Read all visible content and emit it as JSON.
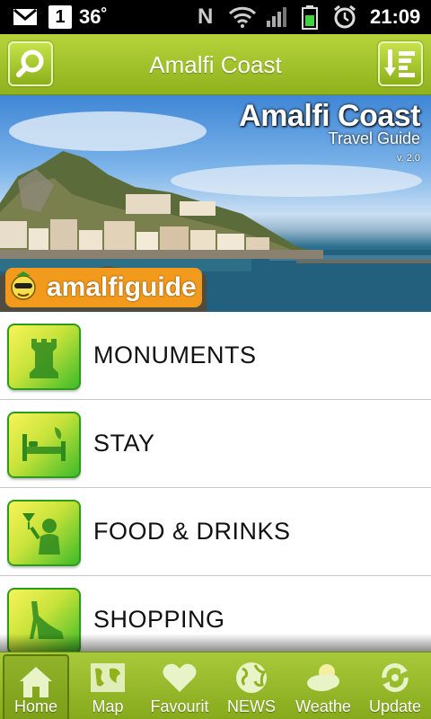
{
  "status_bar": {
    "temperature": "36˚",
    "badge_number": "1",
    "carrier_letter": "N",
    "time": "21:09"
  },
  "header": {
    "title": "Amalfi Coast",
    "search_icon": "search-icon",
    "sort_icon": "sort-list-icon"
  },
  "banner": {
    "title": "Amalfi Coast",
    "subtitle": "Travel Guide",
    "version": "v. 2.0",
    "logo_text": "amalfiguide"
  },
  "menu": {
    "items": [
      {
        "label": "MONUMENTS",
        "icon": "monument-icon"
      },
      {
        "label": "STAY",
        "icon": "bed-icon"
      },
      {
        "label": "FOOD & DRINKS",
        "icon": "drinks-icon"
      },
      {
        "label": "SHOPPING",
        "icon": "shoe-icon"
      }
    ]
  },
  "bottom_nav": {
    "items": [
      {
        "label": "Home",
        "icon": "home-icon",
        "active": true
      },
      {
        "label": "Map",
        "icon": "map-icon",
        "active": false
      },
      {
        "label": "Favourit",
        "icon": "heart-icon",
        "active": false
      },
      {
        "label": "NEWS",
        "icon": "globe-icon",
        "active": false
      },
      {
        "label": "Weathe",
        "icon": "weather-icon",
        "active": false
      },
      {
        "label": "Update",
        "icon": "refresh-icon",
        "active": false
      }
    ]
  },
  "colors": {
    "header_green": "#a3c42c",
    "icon_green": "#3ebb2a",
    "icon_yellow": "#f7f45a",
    "logo_orange": "#f29a1c"
  }
}
